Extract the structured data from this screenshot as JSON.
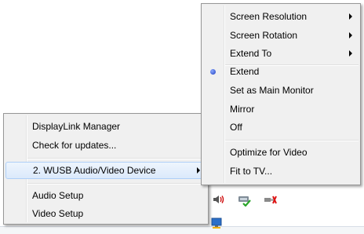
{
  "context_menu_left": {
    "items": [
      {
        "label": "DisplayLink Manager"
      },
      {
        "label": "Check for updates..."
      },
      {
        "label": "2. WUSB Audio/Video Device"
      },
      {
        "label": "Audio Setup"
      },
      {
        "label": "Video Setup"
      }
    ]
  },
  "context_menu_right": {
    "items": [
      {
        "label": "Screen Resolution"
      },
      {
        "label": "Screen Rotation"
      },
      {
        "label": "Extend To"
      },
      {
        "label": "Extend"
      },
      {
        "label": "Set as Main Monitor"
      },
      {
        "label": "Mirror"
      },
      {
        "label": "Off"
      },
      {
        "label": "Optimize for Video"
      },
      {
        "label": "Fit to TV..."
      }
    ]
  },
  "tray": {
    "icons": [
      "speaker-icon",
      "network-check-icon",
      "usb-error-icon",
      "monitor-icon"
    ]
  }
}
